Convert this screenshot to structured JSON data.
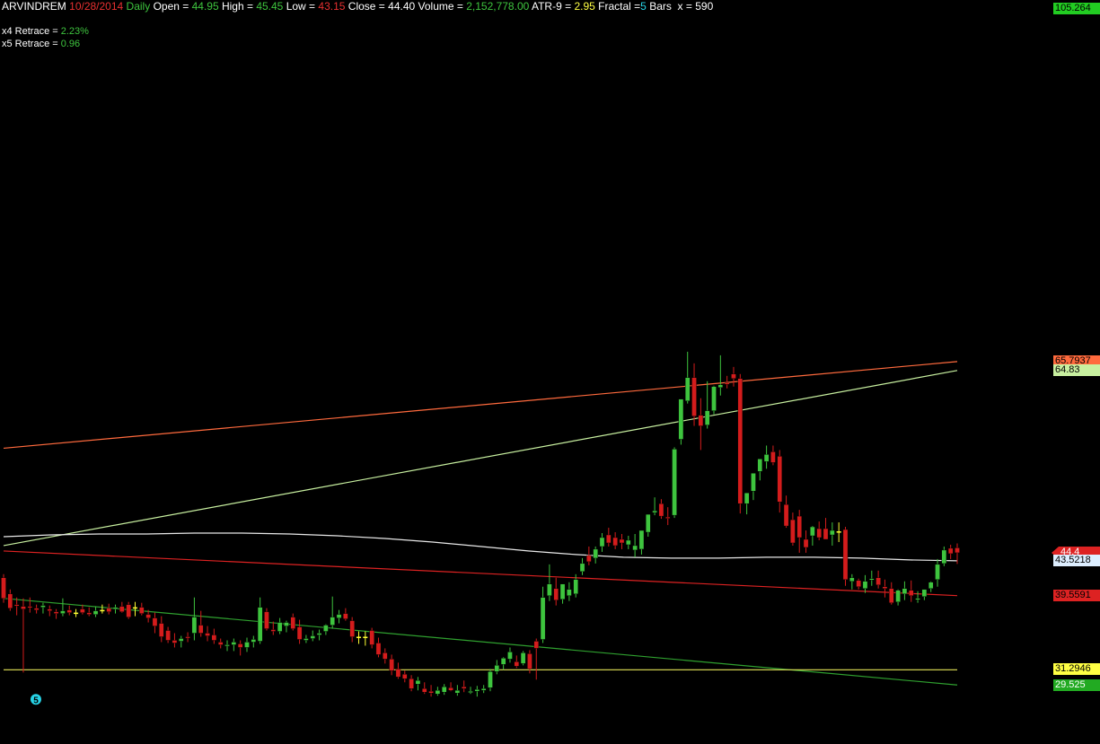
{
  "header": {
    "symbol": "ARVINDREM",
    "date": "10/28/2014",
    "period": "Daily",
    "open_label": "Open = ",
    "open": "44.95",
    "high_label": "High = ",
    "high": "45.45",
    "low_label": "Low = ",
    "low": "43.15",
    "close_label": "Close = ",
    "close": "44.40",
    "volume_label": "Volume = ",
    "volume": "2,152,778.00",
    "atr_label": "ATR-9 = ",
    "atr": "2.95",
    "fractal_label": "Fractal =",
    "fractal": "5",
    "bars_label": "Bars  x = ",
    "bars": "590"
  },
  "retrace": [
    {
      "label": "x4 Retrace = ",
      "value": "2.23%"
    },
    {
      "label": "x5 Retrace = ",
      "value": "0.96"
    }
  ],
  "colors": {
    "up": "#3ec43e",
    "down": "#d41c1c",
    "doji": "#ffff33",
    "upper_channel": "#ff6a3d",
    "upper_channel_2": "#c8f0a0",
    "ma_white": "#e8e8e8",
    "red_line": "#dd2222",
    "green_line": "#2fa02f",
    "yellow_line": "#e6e65a",
    "fractal_marker": "#27d3e6"
  },
  "price_tags": [
    {
      "value": "105.264",
      "bg": "#22cc22",
      "fg": "#000000",
      "price": 105.264
    },
    {
      "value": "65.7937",
      "bg": "#ff6a3d",
      "fg": "#000000",
      "price": 65.7937
    },
    {
      "value": "64.83",
      "bg": "#c8f0a0",
      "fg": "#000000",
      "price": 64.83
    },
    {
      "value": "44.4",
      "bg": "#dd2222",
      "fg": "#ffffff",
      "price": 44.4
    },
    {
      "value": "43.5218",
      "bg": "#ddeeff",
      "fg": "#000000",
      "price": 43.5218
    },
    {
      "value": "39.5591",
      "bg": "#dd2222",
      "fg": "#000000",
      "price": 39.5591
    },
    {
      "value": "31.2946",
      "bg": "#ffff44",
      "fg": "#000000",
      "price": 31.2946
    },
    {
      "value": "29.525",
      "bg": "#22aa22",
      "fg": "#ffffff",
      "price": 29.525
    }
  ],
  "fractal_marker_label": "5",
  "chart_data": {
    "type": "candlestick",
    "title": "ARVINDREM 10/28/2014 Daily",
    "ylim": [
      28.5,
      105.264
    ],
    "candles": [
      [
        41.6,
        42.0,
        38.8,
        39.3
      ],
      [
        39.8,
        40.3,
        37.9,
        38.2
      ],
      [
        38.6,
        39.4,
        37.4,
        38.5
      ],
      [
        38.4,
        39.3,
        31.0,
        38.1
      ],
      [
        38.4,
        39.4,
        37.7,
        38.3
      ],
      [
        38.2,
        38.6,
        37.6,
        38.0
      ],
      [
        38.3,
        38.8,
        37.6,
        38.5
      ],
      [
        38.1,
        38.5,
        37.3,
        37.9
      ],
      [
        37.8,
        38.1,
        37.0,
        37.6
      ],
      [
        37.6,
        39.3,
        37.3,
        37.9
      ],
      [
        38.0,
        38.5,
        37.4,
        37.7
      ],
      [
        37.7,
        38.1,
        37.2,
        37.7
      ],
      [
        38.1,
        38.6,
        37.5,
        37.7
      ],
      [
        37.7,
        38.3,
        37.3,
        37.5
      ],
      [
        37.5,
        38.4,
        37.2,
        37.9
      ],
      [
        38.0,
        38.6,
        37.6,
        38.0
      ],
      [
        38.2,
        38.7,
        37.5,
        37.8
      ],
      [
        38.1,
        38.6,
        37.6,
        38.3
      ],
      [
        38.4,
        38.9,
        37.7,
        37.8
      ],
      [
        38.6,
        38.9,
        37.0,
        37.2
      ],
      [
        38.3,
        38.9,
        37.3,
        38.3
      ],
      [
        38.3,
        38.8,
        37.4,
        37.6
      ],
      [
        37.5,
        38.0,
        36.6,
        37.1
      ],
      [
        37.1,
        37.7,
        35.4,
        36.2
      ],
      [
        36.5,
        37.3,
        34.4,
        35.0
      ],
      [
        35.7,
        36.1,
        34.3,
        34.6
      ],
      [
        34.6,
        35.4,
        33.8,
        34.3
      ],
      [
        34.5,
        35.1,
        33.8,
        34.8
      ],
      [
        35.0,
        35.5,
        34.4,
        34.9
      ],
      [
        35.4,
        39.4,
        34.6,
        37.2
      ],
      [
        36.3,
        37.9,
        35.0,
        35.4
      ],
      [
        35.4,
        36.2,
        34.5,
        35.1
      ],
      [
        35.2,
        35.9,
        34.2,
        34.6
      ],
      [
        34.4,
        34.8,
        33.7,
        34.1
      ],
      [
        34.0,
        34.6,
        33.4,
        34.1
      ],
      [
        34.1,
        34.8,
        33.4,
        34.4
      ],
      [
        34.2,
        34.6,
        32.9,
        33.8
      ],
      [
        33.8,
        34.9,
        33.3,
        34.4
      ],
      [
        34.4,
        35.1,
        33.8,
        34.7
      ],
      [
        34.5,
        39.4,
        34.2,
        38.3
      ],
      [
        37.8,
        38.2,
        35.7,
        35.9
      ],
      [
        35.8,
        36.7,
        35.2,
        35.6
      ],
      [
        35.6,
        37.1,
        35.3,
        36.6
      ],
      [
        36.2,
        36.8,
        35.5,
        36.6
      ],
      [
        37.2,
        37.6,
        35.7,
        35.9
      ],
      [
        36.1,
        36.9,
        34.2,
        34.7
      ],
      [
        34.6,
        35.2,
        34.3,
        34.8
      ],
      [
        34.8,
        35.7,
        34.5,
        35.1
      ],
      [
        35.2,
        35.8,
        34.6,
        35.4
      ],
      [
        35.6,
        36.4,
        35.2,
        36.3
      ],
      [
        36.3,
        39.5,
        35.9,
        37.2
      ],
      [
        37.1,
        38.0,
        36.5,
        37.5
      ],
      [
        37.6,
        38.2,
        36.8,
        37.0
      ],
      [
        36.8,
        37.2,
        34.4,
        35.0
      ],
      [
        35.0,
        35.6,
        34.2,
        35.0
      ],
      [
        35.0,
        35.6,
        34.0,
        35.0
      ],
      [
        35.7,
        36.0,
        33.7,
        34.1
      ],
      [
        34.3,
        34.9,
        32.7,
        33.0
      ],
      [
        33.2,
        33.7,
        32.0,
        32.5
      ],
      [
        32.5,
        33.0,
        30.7,
        31.2
      ],
      [
        31.4,
        32.1,
        30.3,
        30.5
      ],
      [
        30.8,
        31.2,
        29.9,
        30.3
      ],
      [
        30.3,
        30.7,
        28.9,
        29.2
      ],
      [
        29.7,
        30.5,
        29.0,
        30.1
      ],
      [
        29.2,
        29.9,
        28.6,
        28.8
      ],
      [
        28.9,
        29.6,
        28.3,
        28.7
      ],
      [
        28.6,
        29.4,
        28.4,
        29.0
      ],
      [
        28.8,
        29.7,
        28.5,
        29.4
      ],
      [
        29.3,
        29.9,
        28.9,
        29.0
      ],
      [
        28.7,
        29.6,
        28.4,
        29.0
      ],
      [
        29.4,
        30.1,
        28.8,
        29.2
      ],
      [
        28.8,
        29.4,
        28.6,
        28.9
      ],
      [
        28.9,
        29.5,
        28.3,
        29.1
      ],
      [
        29.0,
        29.6,
        28.7,
        29.2
      ],
      [
        29.3,
        31.4,
        28.9,
        31.1
      ],
      [
        31.1,
        32.4,
        30.8,
        31.8
      ],
      [
        31.9,
        32.7,
        31.3,
        32.6
      ],
      [
        32.5,
        33.8,
        32.1,
        33.3
      ],
      [
        32.2,
        32.9,
        31.5,
        31.7
      ],
      [
        32.0,
        33.4,
        31.8,
        33.2
      ],
      [
        33.1,
        33.5,
        30.9,
        31.4
      ],
      [
        34.5,
        34.8,
        30.2,
        33.7
      ],
      [
        34.7,
        40.6,
        34.3,
        39.4
      ],
      [
        39.6,
        43.1,
        39.0,
        40.9
      ],
      [
        40.4,
        41.6,
        38.5,
        39.1
      ],
      [
        39.2,
        40.8,
        38.7,
        40.9
      ],
      [
        39.6,
        41.1,
        39.0,
        40.3
      ],
      [
        39.8,
        42.0,
        39.4,
        41.4
      ],
      [
        42.3,
        43.8,
        41.9,
        43.2
      ],
      [
        44.1,
        45.1,
        43.0,
        43.4
      ],
      [
        43.8,
        45.1,
        43.2,
        44.8
      ],
      [
        45.1,
        46.6,
        44.5,
        46.1
      ],
      [
        46.4,
        47.2,
        45.1,
        45.5
      ],
      [
        46.1,
        46.7,
        44.8,
        45.2
      ],
      [
        45.9,
        46.5,
        44.8,
        45.5
      ],
      [
        45.3,
        46.3,
        44.8,
        45.8
      ],
      [
        44.7,
        46.5,
        43.9,
        45.2
      ],
      [
        44.8,
        46.5,
        44.2,
        46.9
      ],
      [
        46.7,
        48.7,
        46.2,
        48.7
      ],
      [
        48.9,
        50.6,
        48.6,
        49.1
      ],
      [
        49.9,
        50.4,
        48.2,
        48.5
      ],
      [
        48.4,
        49.5,
        47.5,
        48.3
      ],
      [
        48.6,
        56.2,
        48.3,
        56.0
      ],
      [
        57.1,
        59.5,
        56.5,
        61.6
      ],
      [
        61.4,
        66.9,
        61.1,
        64.0
      ],
      [
        64.0,
        65.6,
        58.6,
        59.7
      ],
      [
        59.8,
        61.7,
        55.9,
        58.6
      ],
      [
        58.7,
        63.6,
        58.3,
        60.3
      ],
      [
        60.3,
        63.1,
        59.9,
        63.0
      ],
      [
        62.9,
        66.5,
        62.0,
        63.2
      ],
      [
        63.4,
        64.2,
        62.8,
        63.3
      ],
      [
        64.4,
        65.2,
        63.0,
        63.9
      ],
      [
        63.9,
        64.4,
        48.8,
        49.9
      ],
      [
        49.9,
        50.6,
        48.7,
        51.1
      ],
      [
        51.3,
        52.1,
        50.3,
        53.3
      ],
      [
        53.5,
        54.7,
        52.5,
        54.9
      ],
      [
        54.6,
        56.4,
        53.8,
        55.4
      ],
      [
        55.7,
        56.4,
        54.2,
        54.5
      ],
      [
        55.2,
        55.9,
        48.9,
        50.1
      ],
      [
        49.8,
        50.8,
        47.2,
        47.4
      ],
      [
        48.1,
        48.9,
        45.2,
        45.5
      ],
      [
        48.5,
        49.2,
        44.4,
        46.1
      ],
      [
        45.9,
        46.9,
        44.4,
        45.0
      ],
      [
        46.3,
        47.4,
        45.2,
        47.3
      ],
      [
        47.1,
        47.9,
        45.8,
        46.1
      ],
      [
        47.1,
        48.3,
        45.9,
        45.9
      ],
      [
        46.4,
        47.8,
        45.2,
        46.9
      ],
      [
        46.8,
        47.8,
        45.6,
        46.8
      ],
      [
        47.0,
        47.3,
        40.7,
        41.4
      ],
      [
        41.2,
        42.0,
        40.3,
        41.6
      ],
      [
        41.3,
        41.5,
        40.3,
        40.6
      ],
      [
        40.4,
        41.9,
        39.9,
        41.2
      ],
      [
        41.4,
        42.4,
        40.7,
        41.5
      ],
      [
        41.6,
        42.4,
        40.4,
        40.8
      ],
      [
        40.6,
        41.4,
        39.4,
        40.4
      ],
      [
        40.4,
        41.1,
        38.6,
        38.8
      ],
      [
        38.9,
        40.3,
        38.5,
        40.2
      ],
      [
        39.8,
        41.2,
        39.1,
        40.4
      ],
      [
        40.2,
        41.3,
        38.9,
        39.6
      ],
      [
        39.2,
        40.1,
        38.8,
        39.3
      ],
      [
        39.5,
        40.3,
        39.1,
        40.3
      ],
      [
        40.4,
        41.2,
        40.0,
        41.1
      ],
      [
        41.4,
        43.7,
        40.6,
        43.1
      ],
      [
        43.2,
        45.1,
        42.9,
        44.7
      ],
      [
        44.9,
        45.3,
        43.7,
        44.3
      ],
      [
        44.95,
        45.45,
        43.15,
        44.4
      ]
    ],
    "lines": [
      {
        "name": "upper-channel-orange",
        "from": [
          0,
          56.1
        ],
        "to": [
          1.0,
          65.8
        ]
      },
      {
        "name": "upper-channel-lightgreen",
        "from": [
          0,
          45.2
        ],
        "to": [
          1.0,
          64.8
        ]
      },
      {
        "name": "red-line",
        "from": [
          0,
          44.6
        ],
        "to": [
          1.0,
          39.6
        ]
      },
      {
        "name": "green-line",
        "from": [
          0,
          39.3
        ],
        "to": [
          1.0,
          29.6
        ]
      },
      {
        "name": "yellow-line",
        "from": [
          0,
          31.3
        ],
        "to": [
          1.0,
          31.3
        ]
      }
    ],
    "ma_white": [
      [
        0,
        46.2
      ],
      [
        0.05,
        46.4
      ],
      [
        0.1,
        46.5
      ],
      [
        0.15,
        46.5
      ],
      [
        0.2,
        46.6
      ],
      [
        0.25,
        46.6
      ],
      [
        0.3,
        46.5
      ],
      [
        0.35,
        46.3
      ],
      [
        0.4,
        46.0
      ],
      [
        0.45,
        45.6
      ],
      [
        0.5,
        45.1
      ],
      [
        0.55,
        44.6
      ],
      [
        0.6,
        44.2
      ],
      [
        0.65,
        43.9
      ],
      [
        0.7,
        43.8
      ],
      [
        0.75,
        43.8
      ],
      [
        0.8,
        43.9
      ],
      [
        0.85,
        43.9
      ],
      [
        0.9,
        43.8
      ],
      [
        0.95,
        43.6
      ],
      [
        1.0,
        43.5
      ]
    ],
    "fractal_marker": {
      "bar": 3,
      "price": 30.2,
      "label": "5"
    }
  }
}
